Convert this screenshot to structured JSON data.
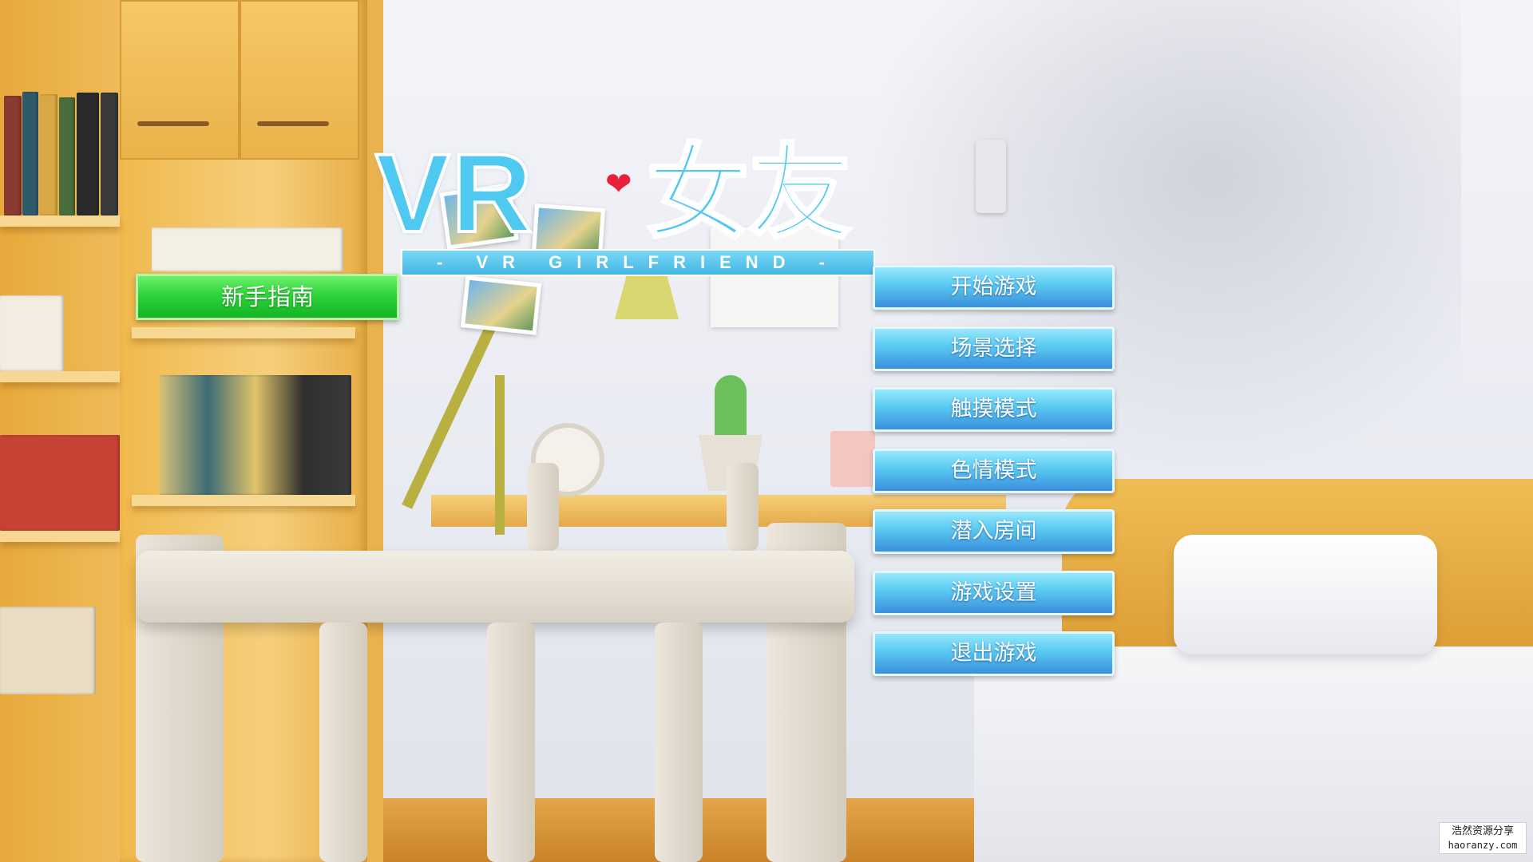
{
  "logo": {
    "title_latin": "VR",
    "title_cn": "女友",
    "subtitle": "- VR GIRLFRIEND -"
  },
  "guide_button": {
    "label": "新手指南"
  },
  "menu": {
    "items": [
      {
        "label": "开始游戏"
      },
      {
        "label": "场景选择"
      },
      {
        "label": "触摸模式"
      },
      {
        "label": "色情模式"
      },
      {
        "label": "潜入房间"
      },
      {
        "label": "游戏设置"
      },
      {
        "label": "退出游戏"
      }
    ]
  },
  "watermark": {
    "cn": "浩然资源分享",
    "url": "haoranzy.com"
  },
  "colors": {
    "menu_button": "#5ccdf2",
    "guide_button": "#2fd43c",
    "logo": "#4fc9f0",
    "heart": "#e8203a"
  }
}
